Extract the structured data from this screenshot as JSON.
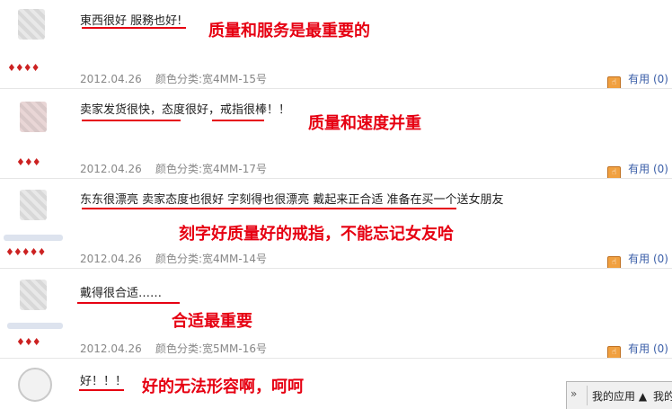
{
  "reviews": [
    {
      "comment": "東西很好 服務也好!",
      "date": "2012.04.26",
      "spec": "颜色分类:宽4MM-15号",
      "useful": "有用 (0)",
      "annotation": "质量和服务是最重要的",
      "gem_icons": "♦♦♦♦"
    },
    {
      "comment": "卖家发货很快，态度很好，戒指很棒！！",
      "date": "2012.04.26",
      "spec": "颜色分类:宽4MM-17号",
      "useful": "有用 (0)",
      "annotation": "质量和速度并重",
      "gem_icons": "♦♦♦"
    },
    {
      "comment": "东东很漂亮 卖家态度也很好 字刻得也很漂亮 戴起来正合适 准备在买一个送女朋友",
      "date": "2012.04.26",
      "spec": "颜色分类:宽4MM-14号",
      "useful": "有用 (0)",
      "annotation": "刻字好质量好的戒指，不能忘记女友哈",
      "gem_icons": "♦♦♦♦♦"
    },
    {
      "comment": "戴得很合适……",
      "date": "2012.04.26",
      "spec": "颜色分类:宽5MM-16号",
      "useful": "有用 (0)",
      "annotation": "合适最重要",
      "gem_icons": "♦♦♦"
    },
    {
      "comment": "好！！！",
      "annotation": "好的无法形容啊，呵呵"
    }
  ],
  "taskbar": {
    "chevron": "»",
    "apps_label": "我的应用 ▲",
    "truncated_label": "我的"
  },
  "colors": {
    "annotation": "#e60012",
    "useful_link": "#3a5ea8",
    "meta_text": "#888888"
  }
}
